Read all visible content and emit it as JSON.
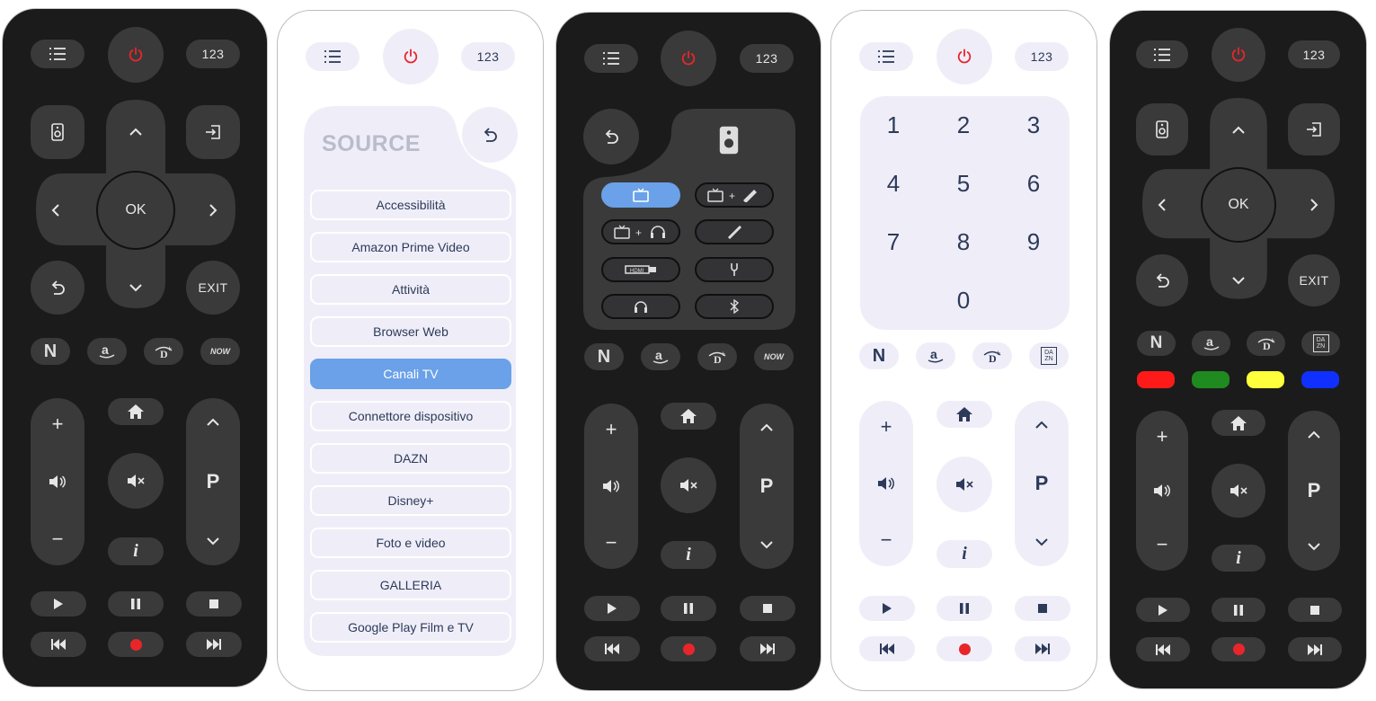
{
  "common": {
    "num_label": "123",
    "ok_label": "OK",
    "exit_label": "EXIT",
    "p_label": "P",
    "info_label": "i",
    "now_label": "NOW",
    "dazn_label": "DA ZN"
  },
  "source_panel": {
    "title": "SOURCE",
    "items": [
      "Accessibilità",
      "Amazon Prime Video",
      "Attività",
      "Browser Web",
      "Canali TV",
      "Connettore dispositivo",
      "DAZN",
      "Disney+",
      "Foto e video",
      "GALLERIA",
      "Google Play Film e TV"
    ],
    "selected_index": 4
  },
  "numpad": {
    "keys": [
      "1",
      "2",
      "3",
      "4",
      "5",
      "6",
      "7",
      "8",
      "9",
      "0"
    ]
  },
  "colors": {
    "dark_bg": "#1b1b1b",
    "dark_button": "#3a3a3b",
    "light_button": "#efeef8",
    "accent_blue": "#6aa1e8",
    "power_red": "#e8262a",
    "color_keys": [
      "#ff1a1a",
      "#1f8a1f",
      "#ffff3c",
      "#1030ff"
    ]
  },
  "icons": [
    "menu-icon",
    "power-icon",
    "speaker-icon",
    "input-icon",
    "back-icon",
    "home-icon",
    "mute-icon",
    "volume-icon",
    "play-icon",
    "pause-icon",
    "stop-icon",
    "rewind-icon",
    "record-icon",
    "fast-forward-icon",
    "netflix-icon",
    "amazon-icon",
    "disney-icon",
    "now-icon",
    "dazn-icon",
    "tv-icon",
    "headphones-icon",
    "hdmi-icon",
    "bluetooth-icon",
    "optical-icon"
  ]
}
